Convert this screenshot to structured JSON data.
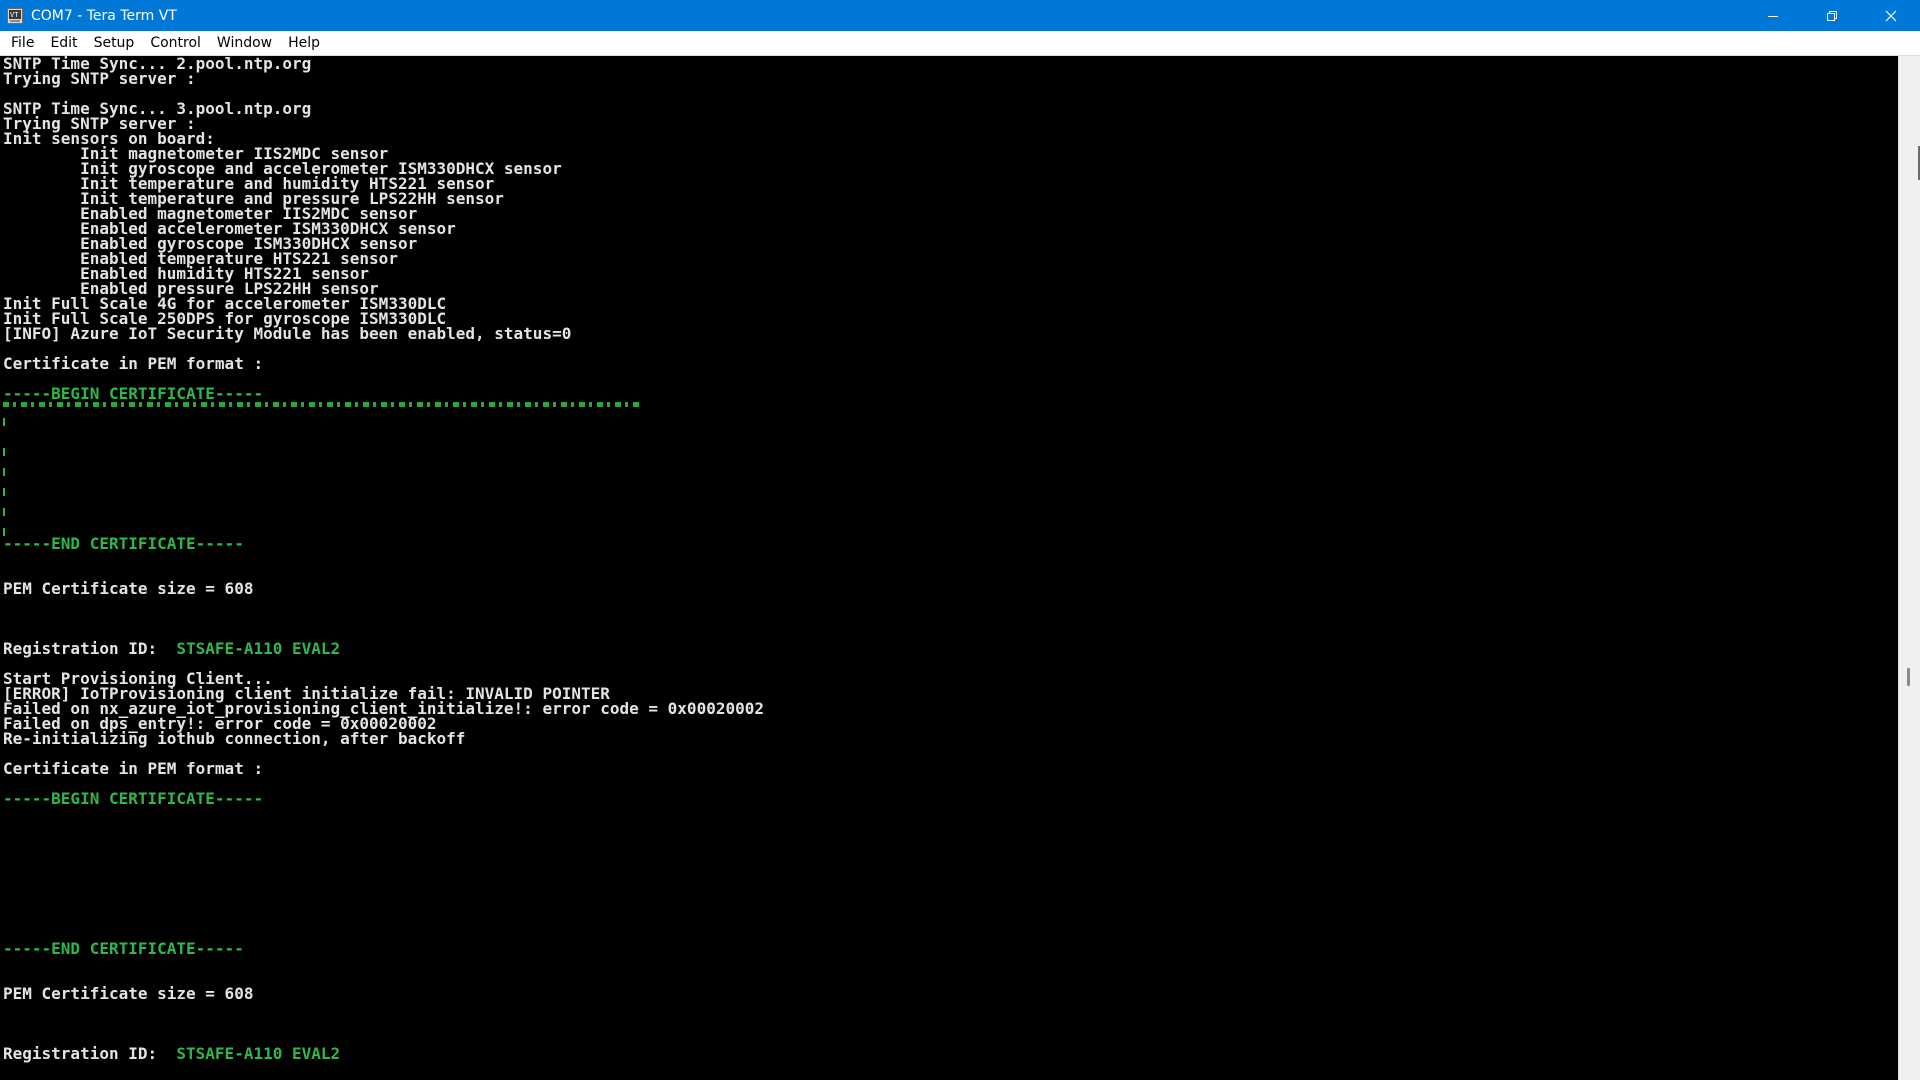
{
  "window": {
    "title": "COM7 - Tera Term VT",
    "app_icon": "tera-term-app-icon",
    "controls": {
      "minimize_icon": "minimize-icon",
      "restore_icon": "restore-icon",
      "close_icon": "close-icon"
    }
  },
  "menu": {
    "items": [
      "File",
      "Edit",
      "Setup",
      "Control",
      "Window",
      "Help"
    ]
  },
  "terminal": {
    "lines": [
      {
        "text": "SNTP Time Sync... 2.pool.ntp.org",
        "color": "default"
      },
      {
        "text": "Trying SNTP server :",
        "color": "default"
      },
      {
        "text": "",
        "color": "default"
      },
      {
        "text": "SNTP Time Sync... 3.pool.ntp.org",
        "color": "default"
      },
      {
        "text": "Trying SNTP server :",
        "color": "default"
      },
      {
        "text": "Init sensors on board:",
        "color": "default"
      },
      {
        "text": "        Init magnetometer IIS2MDC sensor",
        "color": "default"
      },
      {
        "text": "        Init gyroscope and accelerometer ISM330DHCX sensor",
        "color": "default"
      },
      {
        "text": "        Init temperature and humidity HTS221 sensor",
        "color": "default"
      },
      {
        "text": "        Init temperature and pressure LPS22HH sensor",
        "color": "default"
      },
      {
        "text": "        Enabled magnetometer IIS2MDC sensor",
        "color": "default"
      },
      {
        "text": "        Enabled accelerometer ISM330DHCX sensor",
        "color": "default"
      },
      {
        "text": "        Enabled gyroscope ISM330DHCX sensor",
        "color": "default"
      },
      {
        "text": "        Enabled temperature HTS221 sensor",
        "color": "default"
      },
      {
        "text": "        Enabled humidity HTS221 sensor",
        "color": "default"
      },
      {
        "text": "        Enabled pressure LPS22HH sensor",
        "color": "default"
      },
      {
        "text": "Init Full Scale 4G for accelerometer ISM330DLC",
        "color": "default"
      },
      {
        "text": "Init Full Scale 250DPS for gyroscope ISM330DLC",
        "color": "default"
      },
      {
        "text": "[INFO] Azure IoT Security Module has been enabled, status=0",
        "color": "default"
      },
      {
        "text": "",
        "color": "default"
      },
      {
        "text": "Certificate in PEM format :",
        "color": "default"
      },
      {
        "text": "",
        "color": "default"
      },
      {
        "text": "-----BEGIN CERTIFICATE-----",
        "color": "green"
      },
      {
        "text": "",
        "color": "default"
      },
      {
        "text": "",
        "color": "default"
      },
      {
        "text": "",
        "color": "default"
      },
      {
        "text": "",
        "color": "default"
      },
      {
        "text": "",
        "color": "default"
      },
      {
        "text": "",
        "color": "default"
      },
      {
        "text": "",
        "color": "default"
      },
      {
        "text": "",
        "color": "default"
      },
      {
        "text": "",
        "color": "default"
      },
      {
        "text": "-----END CERTIFICATE-----",
        "color": "green"
      },
      {
        "text": "",
        "color": "default"
      },
      {
        "text": "",
        "color": "default"
      },
      {
        "text": "PEM Certificate size = 608",
        "color": "default"
      },
      {
        "text": "",
        "color": "default"
      },
      {
        "text": "",
        "color": "default"
      },
      {
        "text": "",
        "color": "default"
      },
      {
        "text": "Registration ID:  ",
        "color": "default",
        "value": "STSAFE-A110 EVAL2"
      },
      {
        "text": "",
        "color": "default"
      },
      {
        "text": "Start Provisioning Client...",
        "color": "default"
      },
      {
        "text": "[ERROR] IoTProvisioning client initialize fail: INVALID POINTER",
        "color": "default"
      },
      {
        "text": "Failed on nx_azure_iot_provisioning_client_initialize!: error code = 0x00020002",
        "color": "default"
      },
      {
        "text": "Failed on dps_entry!: error code = 0x00020002",
        "color": "default"
      },
      {
        "text": "Re-initializing iothub connection, after backoff",
        "color": "default"
      },
      {
        "text": "",
        "color": "default"
      },
      {
        "text": "Certificate in PEM format :",
        "color": "default"
      },
      {
        "text": "",
        "color": "default"
      },
      {
        "text": "-----BEGIN CERTIFICATE-----",
        "color": "green"
      },
      {
        "text": "",
        "color": "default"
      },
      {
        "text": "",
        "color": "default"
      },
      {
        "text": "",
        "color": "default"
      },
      {
        "text": "",
        "color": "default"
      },
      {
        "text": "",
        "color": "default"
      },
      {
        "text": "",
        "color": "default"
      },
      {
        "text": "",
        "color": "default"
      },
      {
        "text": "",
        "color": "default"
      },
      {
        "text": "",
        "color": "default"
      },
      {
        "text": "-----END CERTIFICATE-----",
        "color": "green"
      },
      {
        "text": "",
        "color": "default"
      },
      {
        "text": "",
        "color": "default"
      },
      {
        "text": "PEM Certificate size = 608",
        "color": "default"
      },
      {
        "text": "",
        "color": "default"
      },
      {
        "text": "",
        "color": "default"
      },
      {
        "text": "",
        "color": "default"
      },
      {
        "text": "Registration ID:  ",
        "color": "default",
        "value": "STSAFE-A110 EVAL2"
      }
    ]
  },
  "colors": {
    "titlebar": "#0078d7",
    "terminal_bg": "#000000",
    "terminal_fg": "#e4e4e4",
    "terminal_green": "#2fb84a"
  }
}
